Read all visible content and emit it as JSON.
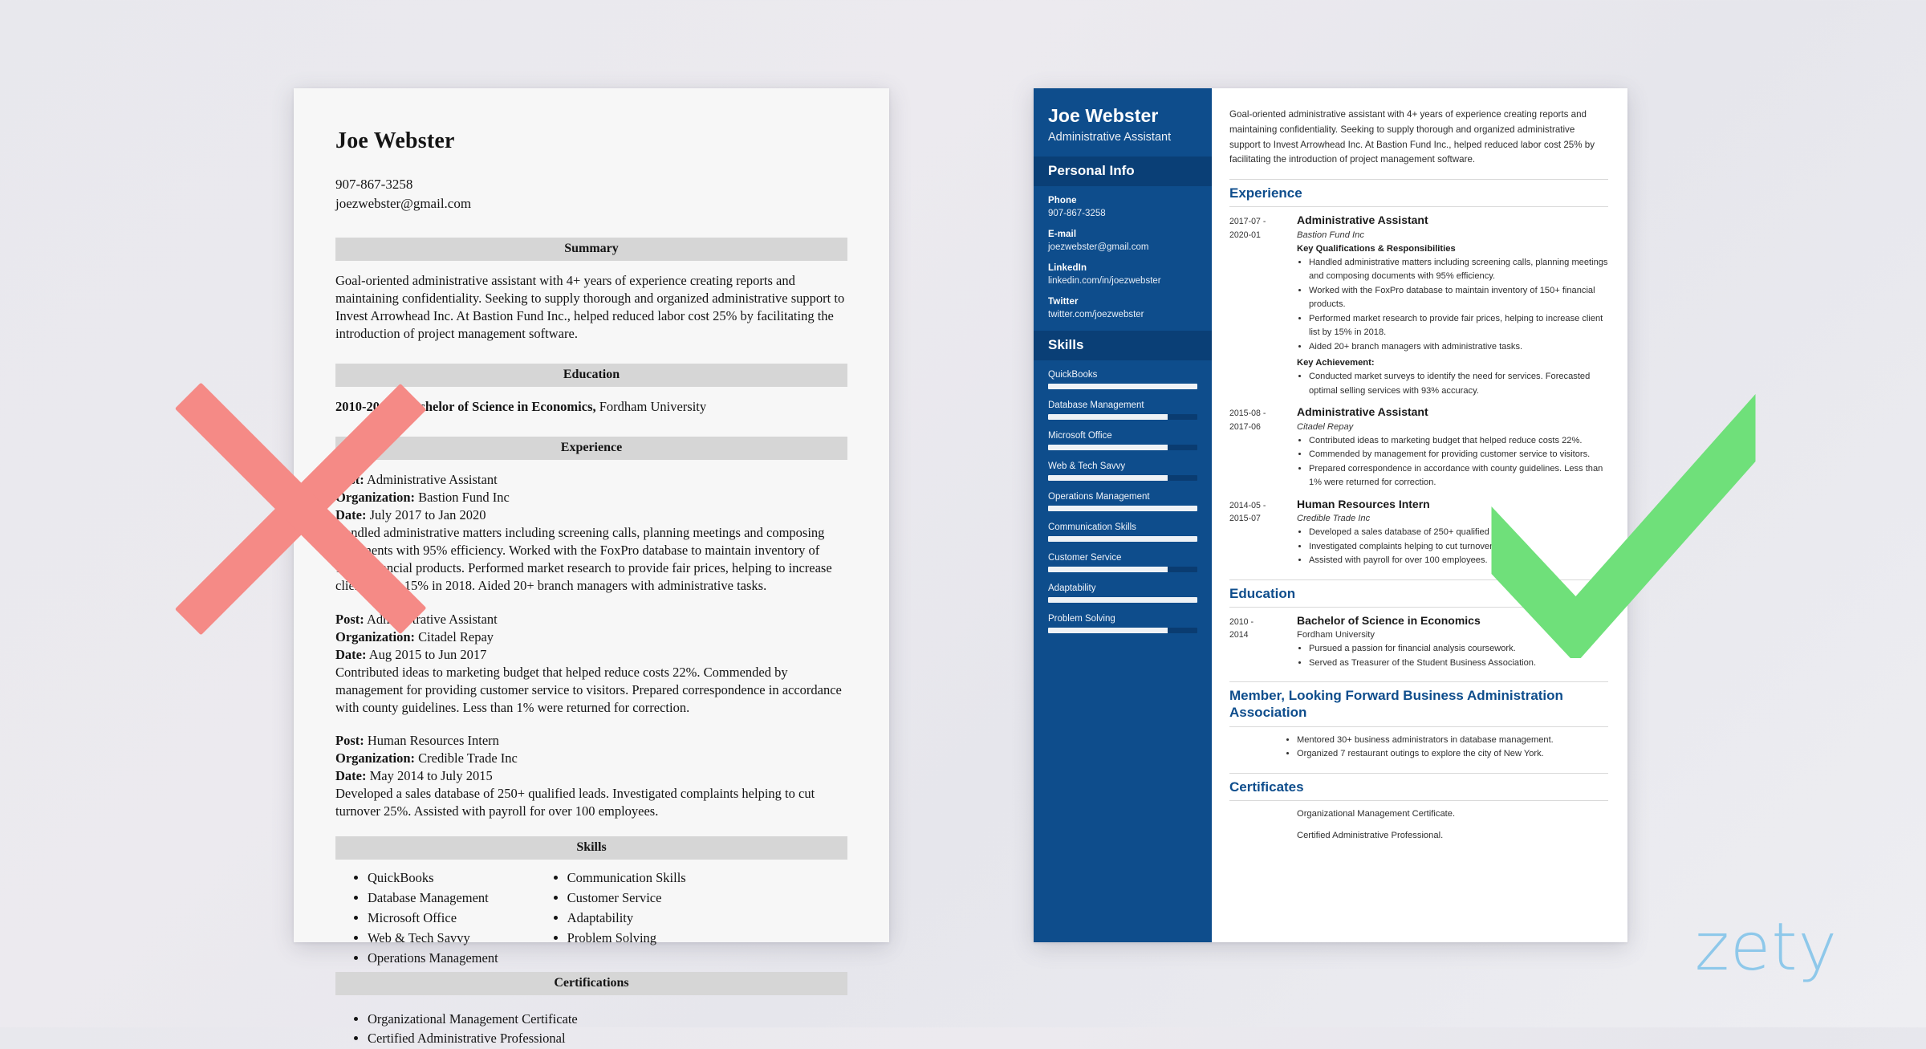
{
  "colors": {
    "sidebar_blue": "#0e4d8c",
    "sidebar_header_blue": "#0a3f76",
    "heading_blue": "#0e4d8c",
    "reject_red": "#f58a86",
    "accept_green": "#6fe07a",
    "watermark_blue": "#8ec8ea",
    "section_bar_grey": "#d6d6d6"
  },
  "watermark": {
    "text": "zety"
  },
  "bad_resume": {
    "name": "Joe Webster",
    "contact": {
      "phone": "907-867-3258",
      "email": "joezwebster@gmail.com"
    },
    "sections": {
      "summary_heading": "Summary",
      "summary_text": "Goal-oriented administrative assistant with 4+ years of experience creating reports and maintaining confidentiality. Seeking to supply thorough and organized administrative support to Invest Arrowhead Inc. At Bastion Fund Inc., helped reduced labor cost 25% by facilitating the introduction of project management software.",
      "education_heading": "Education",
      "education_years": "2010-2014 - Bachelor of Science in Economics,",
      "education_school": " Fordham University",
      "experience_heading": "Experience",
      "skills_heading": "Skills",
      "certifications_heading": "Certifications"
    },
    "labels": {
      "post": "Post:",
      "organization": "Organization:",
      "date": "Date:"
    },
    "jobs": [
      {
        "post": " Administrative Assistant",
        "organization": " Bastion Fund Inc",
        "date": " July 2017 to Jan 2020",
        "description": "Handled administrative matters including screening calls, planning meetings and composing documents with 95% efficiency. Worked with the FoxPro database to maintain inventory of 150+ financial products. Performed market research to provide fair prices, helping to increase client list by 15% in 2018. Aided 20+ branch managers with administrative tasks."
      },
      {
        "post": " Administrative Assistant",
        "organization": " Citadel Repay",
        "date": " Aug 2015 to Jun 2017",
        "description": "Contributed ideas to marketing budget that helped reduce costs 22%. Commended by management for providing customer service to visitors. Prepared correspondence in accordance with county guidelines. Less than 1% were returned for correction."
      },
      {
        "post": " Human Resources Intern",
        "organization": " Credible Trade Inc",
        "date": " May 2014 to July 2015",
        "description": "Developed a sales database of 250+ qualified leads. Investigated complaints helping to cut turnover 25%. Assisted with payroll for over 100 employees."
      }
    ],
    "skills_col1": [
      "QuickBooks",
      "Database Management",
      "Microsoft Office",
      "Web & Tech Savvy",
      "Operations Management"
    ],
    "skills_col2": [
      "Communication Skills",
      "Customer Service",
      "Adaptability",
      "Problem Solving"
    ],
    "certifications": [
      "Organizational Management Certificate",
      "Certified Administrative Professional"
    ]
  },
  "good_resume": {
    "sidebar": {
      "name": "Joe Webster",
      "job_title": "Administrative Assistant",
      "personal_info_heading": "Personal Info",
      "fields": [
        {
          "label": "Phone",
          "value": "907-867-3258"
        },
        {
          "label": "E-mail",
          "value": "joezwebster@gmail.com"
        },
        {
          "label": "LinkedIn",
          "value": "linkedin.com/in/joezwebster"
        },
        {
          "label": "Twitter",
          "value": "twitter.com/joezwebster"
        }
      ],
      "skills_heading": "Skills",
      "skills": [
        {
          "name": "QuickBooks",
          "level": 100
        },
        {
          "name": "Database Management",
          "level": 80
        },
        {
          "name": "Microsoft Office",
          "level": 80
        },
        {
          "name": "Web & Tech Savvy",
          "level": 80
        },
        {
          "name": "Operations Management",
          "level": 100
        },
        {
          "name": "Communication Skills",
          "level": 100
        },
        {
          "name": "Customer Service",
          "level": 80
        },
        {
          "name": "Adaptability",
          "level": 100
        },
        {
          "name": "Problem Solving",
          "level": 80
        }
      ]
    },
    "main": {
      "summary": "Goal-oriented administrative assistant with 4+ years of experience creating reports and maintaining confidentiality. Seeking to supply thorough and organized administrative support to Invest Arrowhead Inc. At Bastion Fund Inc., helped reduced labor cost 25% by facilitating the introduction of project management software.",
      "experience_heading": "Experience",
      "experience": [
        {
          "date_from": "2017-07 -",
          "date_to": "2020-01",
          "role": "Administrative Assistant",
          "org": "Bastion Fund Inc",
          "sub1": "Key Qualifications & Responsibilities",
          "bullets1": [
            "Handled administrative matters including screening calls, planning meetings and composing documents with 95% efficiency.",
            "Worked with the FoxPro database to maintain inventory of 150+ financial products.",
            "Performed market research to provide fair prices, helping to increase client list by 15% in 2018.",
            "Aided 20+ branch managers with administrative tasks."
          ],
          "sub2": "Key Achievement:",
          "bullets2": [
            "Conducted market surveys to identify the need for services. Forecasted optimal selling services with 93% accuracy."
          ]
        },
        {
          "date_from": "2015-08 -",
          "date_to": "2017-06",
          "role": "Administrative Assistant",
          "org": "Citadel Repay",
          "bullets1": [
            "Contributed ideas to marketing budget that helped reduce costs 22%.",
            "Commended by management for providing customer service to visitors.",
            "Prepared correspondence in accordance with county guidelines. Less than 1% were returned for correction."
          ]
        },
        {
          "date_from": "2014-05 -",
          "date_to": "2015-07",
          "role": "Human Resources Intern",
          "org": "Credible Trade Inc",
          "bullets1": [
            "Developed a sales database of 250+ qualified leads.",
            "Investigated complaints helping to cut turnover 25%.",
            "Assisted with payroll for over 100 employees."
          ]
        }
      ],
      "education_heading": "Education",
      "education": {
        "date_from": "2010 -",
        "date_to": "2014",
        "degree": "Bachelor of Science in Economics",
        "school": "Fordham University",
        "bullets": [
          "Pursued a passion for financial analysis coursework.",
          "Served as Treasurer of the Student Business Association."
        ]
      },
      "association_heading": "Member, Looking Forward Business Administration Association",
      "association_bullets": [
        "Mentored 30+ business administrators in database management.",
        "Organized 7 restaurant outings to explore the city of New York."
      ],
      "certificates_heading": "Certificates",
      "certificates": [
        "Organizational Management Certificate.",
        "Certified Administrative Professional."
      ]
    }
  }
}
